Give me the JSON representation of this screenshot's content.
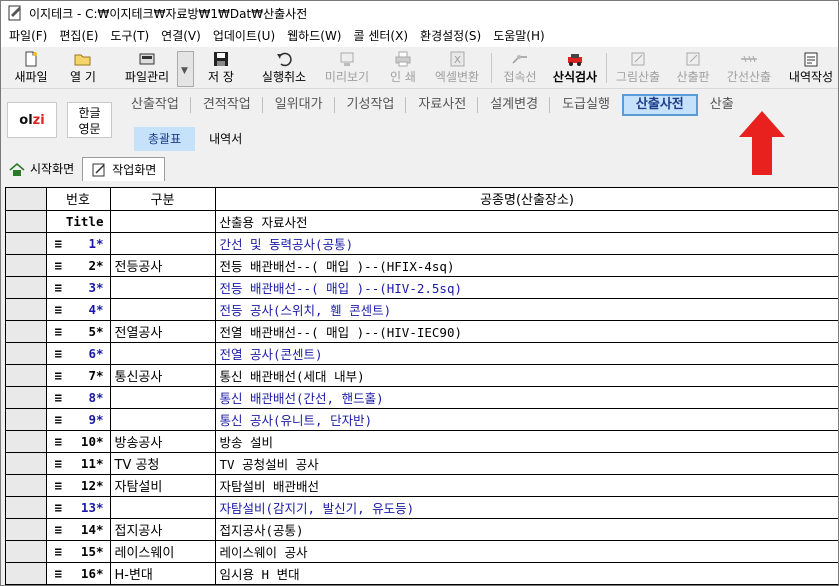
{
  "window": {
    "title": "이지테크 - C:₩이지테크₩자료방₩1₩Dat₩산출사전"
  },
  "menu": [
    "파일(F)",
    "편집(E)",
    "도구(T)",
    "연결(V)",
    "업데이트(U)",
    "웹하드(W)",
    "콜 센터(X)",
    "환경설정(S)",
    "도움말(H)"
  ],
  "toolbar": {
    "new": "새파일",
    "open": "열 기",
    "fileManage": "파일관리",
    "save": "저 장",
    "undo": "실행취소",
    "preview": "미리보기",
    "print": "인 쇄",
    "excel": "엑셀변환",
    "connect": "접속선",
    "formulaCheck": "산식검사",
    "drawCalc": "그림산출",
    "calcBoard": "산출판",
    "trunkCalc": "간선산출",
    "itemize": "내역작성"
  },
  "logo": {
    "text": "ol",
    "accent": "zi"
  },
  "lang": {
    "line1": "한글",
    "line2": "영문"
  },
  "tabs": [
    "산출작업",
    "견적작업",
    "일위대가",
    "기성작업",
    "자료사전",
    "설계변경",
    "도급실행",
    "산출사전",
    "산출"
  ],
  "subtabs": [
    "총괄표",
    "내역서"
  ],
  "pagetabs": [
    "시작화면",
    "작업화면"
  ],
  "table": {
    "headers": [
      "번호",
      "구분",
      "공종명(산출장소)"
    ],
    "rows": [
      {
        "no": "Title",
        "cat": "",
        "name": "산출용 자료사전",
        "blue": false,
        "eq": false
      },
      {
        "no": "1*",
        "cat": "",
        "name": "간선 및 동력공사(공통)",
        "blue": true,
        "eq": true
      },
      {
        "no": "2*",
        "cat": "전등공사",
        "name": "전등 배관배선--( 매입 )--(HFIX-4sq)",
        "blue": false,
        "eq": true
      },
      {
        "no": "3*",
        "cat": "",
        "name": "전등 배관배선--( 매입 )--(HIV-2.5sq)",
        "blue": true,
        "eq": true
      },
      {
        "no": "4*",
        "cat": "",
        "name": "전등 공사(스위치, 휀 콘센트)",
        "blue": true,
        "eq": true
      },
      {
        "no": "5*",
        "cat": "전열공사",
        "name": "전열 배관배선--( 매입 )--(HIV-IEC90)",
        "blue": false,
        "eq": true
      },
      {
        "no": "6*",
        "cat": "",
        "name": "전열 공사(콘센트)",
        "blue": true,
        "eq": true
      },
      {
        "no": "7*",
        "cat": "통신공사",
        "name": "통신 배관배선(세대 내부)",
        "blue": false,
        "eq": true
      },
      {
        "no": "8*",
        "cat": "",
        "name": "통신 배관배선(간선, 핸드홀)",
        "blue": true,
        "eq": true
      },
      {
        "no": "9*",
        "cat": "",
        "name": "통신 공사(유니트, 단자반)",
        "blue": true,
        "eq": true
      },
      {
        "no": "10*",
        "cat": "방송공사",
        "name": "방송 설비",
        "blue": false,
        "eq": true
      },
      {
        "no": "11*",
        "cat": "TV  공청",
        "name": "TV 공청설비 공사",
        "blue": false,
        "eq": true
      },
      {
        "no": "12*",
        "cat": "자탐설비",
        "name": "자탐설비 배관배선",
        "blue": false,
        "eq": true
      },
      {
        "no": "13*",
        "cat": "",
        "name": "자탐설비(감지기, 발신기, 유도등)",
        "blue": true,
        "eq": true
      },
      {
        "no": "14*",
        "cat": "접지공사",
        "name": "접지공사(공통)",
        "blue": false,
        "eq": true
      },
      {
        "no": "15*",
        "cat": "레이스웨이",
        "name": "레이스웨이 공사",
        "blue": false,
        "eq": true
      },
      {
        "no": "16*",
        "cat": "H-변대",
        "name": "임시용 H 변대",
        "blue": false,
        "eq": true
      }
    ]
  },
  "colors": {
    "activeTab": "#c6e2fb",
    "activeBorder": "#5a9ad6",
    "blueText": "#1a1aa6",
    "arrow": "#e8201e"
  }
}
